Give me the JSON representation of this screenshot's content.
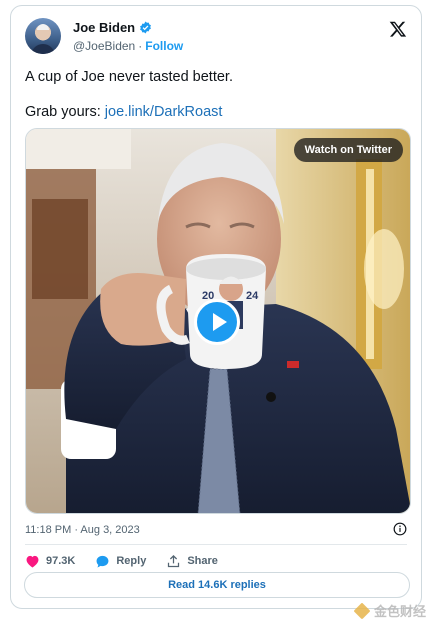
{
  "author": {
    "name": "Joe Biden",
    "handle": "@JoeBiden",
    "separator": "·",
    "follow_label": "Follow"
  },
  "tweet": {
    "line1": "A cup of Joe never tasted better.",
    "line2_prefix": "Grab yours: ",
    "link_text": "joe.link/DarkRoast"
  },
  "media": {
    "watch_label": "Watch on Twitter",
    "mug_year_left": "20",
    "mug_year_right": "24"
  },
  "meta": {
    "timestamp": "11:18 PM · Aug 3, 2023"
  },
  "actions": {
    "likes": "97.3K",
    "reply_label": "Reply",
    "share_label": "Share"
  },
  "replies_button": "Read 14.6K replies",
  "watermark": "金色财经",
  "colors": {
    "accent_blue": "#1d9bf0",
    "like_red": "#f91880",
    "border": "#cfd9de",
    "muted_text": "#536471"
  },
  "icons": [
    "verified-badge-icon",
    "x-logo-icon",
    "play-icon",
    "info-icon",
    "heart-icon",
    "reply-bubble-icon",
    "share-icon"
  ]
}
